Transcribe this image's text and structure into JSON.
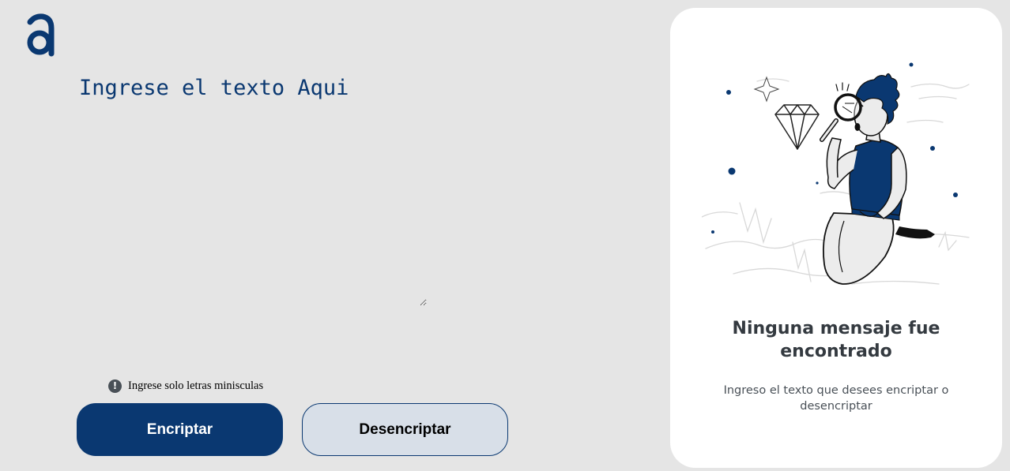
{
  "app": {
    "logo_icon": "alura-logo-icon",
    "accent_color": "#0a3871"
  },
  "editor": {
    "placeholder": "Ingrese el texto Aqui",
    "value": ""
  },
  "hint": {
    "icon": "exclamation-circle-icon",
    "text": "Ingrese solo letras minisculas"
  },
  "actions": {
    "encrypt_label": "Encriptar",
    "decrypt_label": "Desencriptar"
  },
  "output_panel": {
    "illustration": "person-with-magnifying-glass-illustration",
    "title": "Ninguna mensaje fue encontrado",
    "message": "Ingreso el texto que desees encriptar o desencriptar"
  }
}
